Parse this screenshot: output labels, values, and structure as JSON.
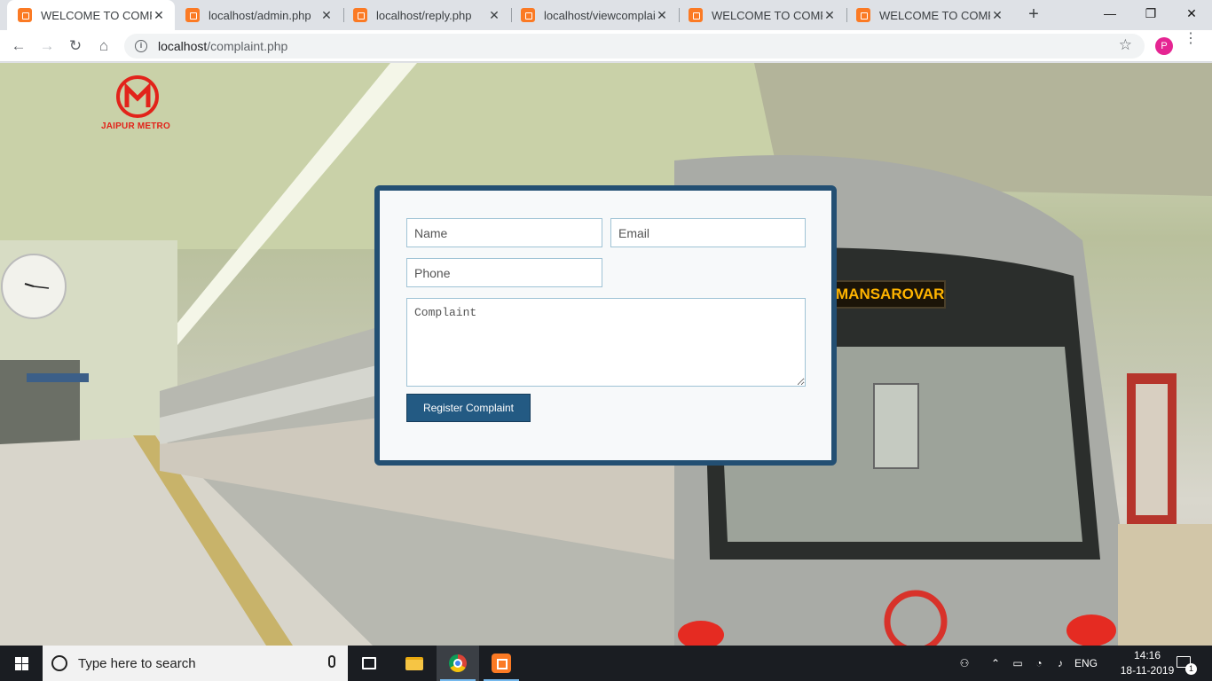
{
  "browser": {
    "tabs": [
      {
        "title": "WELCOME TO COMPLA",
        "active": true
      },
      {
        "title": "localhost/admin.php",
        "active": false
      },
      {
        "title": "localhost/reply.php",
        "active": false
      },
      {
        "title": "localhost/viewcomplain",
        "active": false
      },
      {
        "title": "WELCOME TO COMPLA",
        "active": false
      },
      {
        "title": "WELCOME TO COMPLA",
        "active": false
      }
    ],
    "url_host": "localhost",
    "url_path": "/complaint.php",
    "profile_initial": "P"
  },
  "page": {
    "logo_text": "JAIPUR METRO",
    "destination_board": "MANSAROVAR",
    "form": {
      "name_placeholder": "Name",
      "email_placeholder": "Email",
      "phone_placeholder": "Phone",
      "complaint_placeholder": "Complaint",
      "submit_label": "Register Complaint"
    }
  },
  "taskbar": {
    "search_placeholder": "Type here to search",
    "language": "ENG",
    "time": "14:16",
    "date": "18-11-2019",
    "notification_count": "1"
  },
  "colors": {
    "card_border": "#234f73",
    "submit_bg": "#235a83",
    "metro_red": "#e2231a",
    "board_text": "#ffb400"
  }
}
